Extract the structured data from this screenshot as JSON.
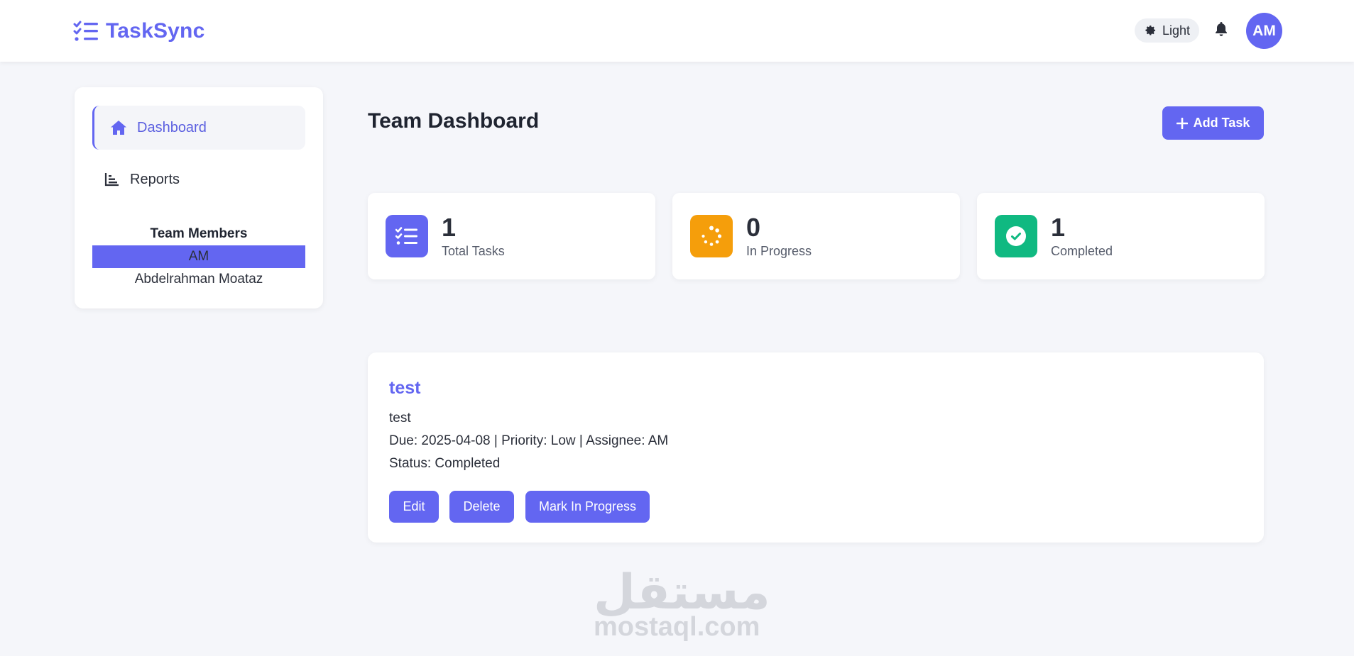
{
  "header": {
    "brand": "TaskSync",
    "theme_toggle_label": "Light",
    "avatar_initials": "AM"
  },
  "sidebar": {
    "items": [
      {
        "label": "Dashboard",
        "icon": "home-icon",
        "active": true
      },
      {
        "label": "Reports",
        "icon": "bar-chart-icon",
        "active": false
      }
    ],
    "team_title": "Team Members",
    "members": [
      {
        "label": "AM",
        "selected": true
      },
      {
        "label": "Abdelrahman Moataz",
        "selected": false
      }
    ]
  },
  "main": {
    "title": "Team Dashboard",
    "add_task_label": "Add Task",
    "stats": [
      {
        "value": "1",
        "label": "Total Tasks",
        "icon": "tasks-icon",
        "color": "#6366f1"
      },
      {
        "value": "0",
        "label": "In Progress",
        "icon": "spinner-icon",
        "color": "#f59e0b"
      },
      {
        "value": "1",
        "label": "Completed",
        "icon": "check-circle-icon",
        "color": "#10b981"
      }
    ]
  },
  "tasks": [
    {
      "title": "test",
      "description": "test",
      "meta": "Due: 2025-04-08 | Priority: Low | Assignee: AM",
      "status": "Status: Completed",
      "actions": {
        "edit": "Edit",
        "delete": "Delete",
        "progress": "Mark In Progress"
      }
    }
  ],
  "watermark": {
    "arabic": "مستقل",
    "latin": "mostaql.com"
  },
  "colors": {
    "accent": "#6366f1",
    "warning": "#f59e0b",
    "success": "#10b981",
    "background": "#f5f6fa"
  }
}
